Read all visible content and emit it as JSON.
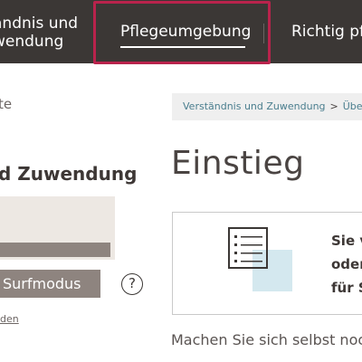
{
  "topnav": {
    "item1": {
      "line1": "ändnis und",
      "line2": "wendung"
    },
    "item2": {
      "label": "Pflegeumgebung"
    },
    "item3": {
      "label": "Richtig pf"
    }
  },
  "sidebar": {
    "small_text": "te",
    "section_title": "d Zuwendung",
    "surf_button": "Surfmodus",
    "help_symbol": "?",
    "link_text": "den"
  },
  "breadcrumb": {
    "items": [
      "Verständnis und Zuwendung",
      "Übe"
    ],
    "separator": ">"
  },
  "main": {
    "title": "Einstieg",
    "card": {
      "line1": "Sie v",
      "line2": "oder",
      "line3": "für S"
    },
    "intro": "Machen Sie sich selbst noc"
  },
  "colors": {
    "nav_bg": "#3b3735",
    "focus_outline": "#b9234c",
    "accent_taupe": "#8e847f",
    "breadcrumb_link": "#4a7e8e",
    "icon_fill": "#d4e8ef"
  },
  "icons": [
    "list-document-icon",
    "help-icon",
    "chevron-right-icon"
  ]
}
